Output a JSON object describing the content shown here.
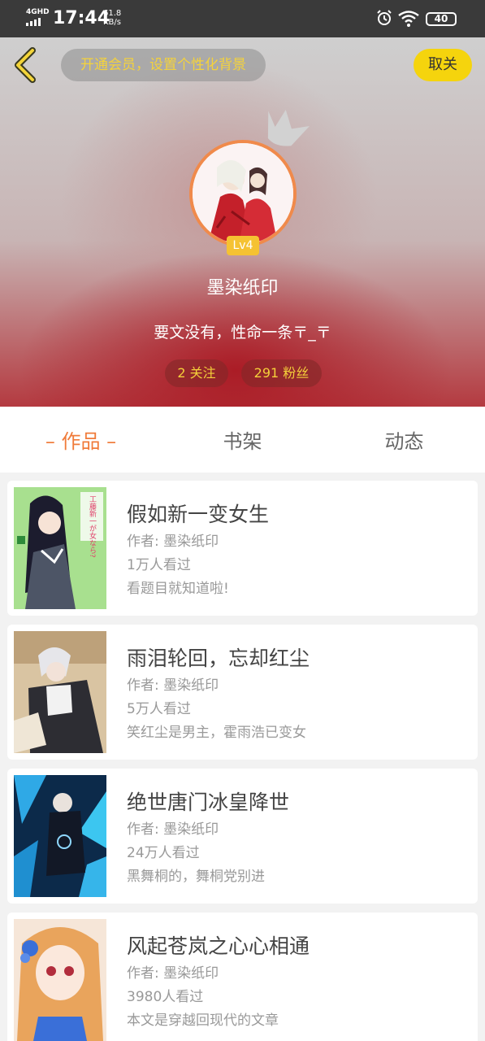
{
  "status_bar": {
    "network": "4GHD",
    "time": "17:44",
    "speed_value": "61.8",
    "speed_unit": "KB/s",
    "battery": "40"
  },
  "header": {
    "vip_banner": "开通会员，设置个性化背景",
    "close_label": "取关",
    "level": "Lv4",
    "username": "墨染纸印",
    "bio": "要文没有，性命一条〒_〒",
    "following": "2 关注",
    "fans": "291 粉丝",
    "colors": {
      "accent": "#f07b3a",
      "vip_text": "#f4d23c",
      "close_bg": "#f5d40d"
    }
  },
  "tabs": [
    {
      "label": "– 作品 –",
      "active": true
    },
    {
      "label": "书架",
      "active": false
    },
    {
      "label": "动态",
      "active": false
    }
  ],
  "books": [
    {
      "title": "假如新一变女生",
      "author": "作者: 墨染纸印",
      "views": "1万人看过",
      "desc": "看题目就知道啦!",
      "cover_text": "工藤新一が女なら?"
    },
    {
      "title": "雨泪轮回，忘却红尘",
      "author": "作者: 墨染纸印",
      "views": "5万人看过",
      "desc": "笑红尘是男主，霍雨浩已变女"
    },
    {
      "title": "绝世唐门冰皇降世",
      "author": "作者: 墨染纸印",
      "views": "24万人看过",
      "desc": "黑舞桐的，舞桐党别进"
    },
    {
      "title": "风起苍岚之心心相通",
      "author": "作者: 墨染纸印",
      "views": "3980人看过",
      "desc": "本文是穿越回现代的文章"
    }
  ]
}
